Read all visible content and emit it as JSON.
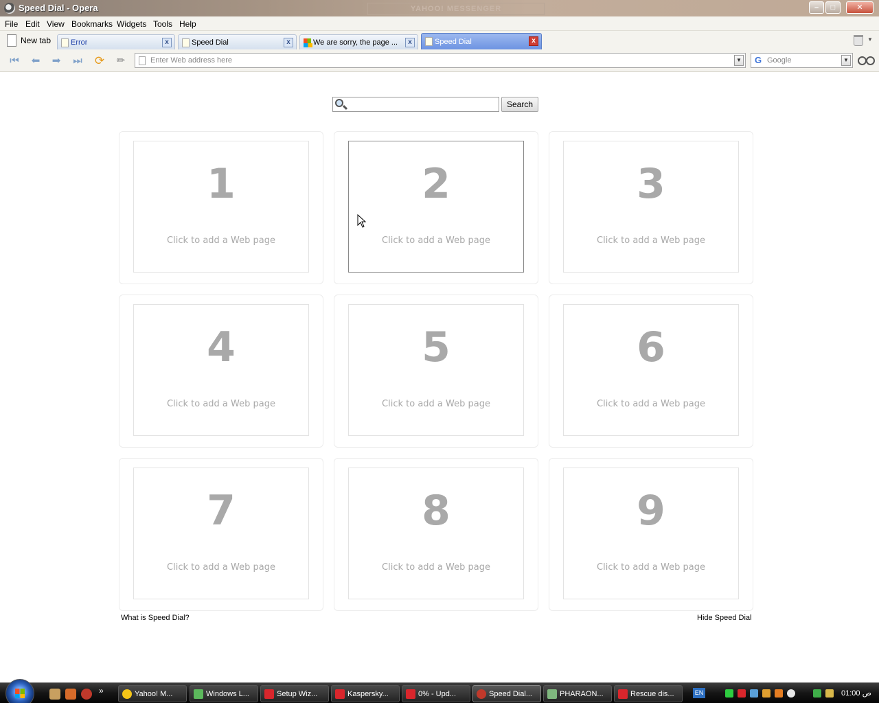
{
  "window": {
    "title": "Speed Dial - Opera",
    "background_watermark": "YAHOO! MESSENGER"
  },
  "menu": [
    "File",
    "Edit",
    "View",
    "Bookmarks",
    "Widgets",
    "Tools",
    "Help"
  ],
  "tabs": {
    "new_tab_label": "New tab",
    "items": [
      {
        "label": "Error",
        "icon": "page-icon",
        "active": false
      },
      {
        "label": "Speed Dial",
        "icon": "page-icon",
        "active": false
      },
      {
        "label": "We are sorry, the page ...",
        "icon": "windows-logo-icon",
        "active": false
      },
      {
        "label": "Speed Dial",
        "icon": "page-icon",
        "active": true
      }
    ]
  },
  "address_bar": {
    "placeholder": "Enter Web address here",
    "search_engine": "Google"
  },
  "speed_dial": {
    "search_button": "Search",
    "tiles": [
      {
        "number": "1",
        "hint": "Click to add a Web page"
      },
      {
        "number": "2",
        "hint": "Click to add a Web page"
      },
      {
        "number": "3",
        "hint": "Click to add a Web page"
      },
      {
        "number": "4",
        "hint": "Click to add a Web page"
      },
      {
        "number": "5",
        "hint": "Click to add a Web page"
      },
      {
        "number": "6",
        "hint": "Click to add a Web page"
      },
      {
        "number": "7",
        "hint": "Click to add a Web page"
      },
      {
        "number": "8",
        "hint": "Click to add a Web page"
      },
      {
        "number": "9",
        "hint": "Click to add a Web page"
      }
    ],
    "what_is_link": "What is Speed Dial?",
    "hide_link": "Hide Speed Dial"
  },
  "taskbar": {
    "tasks": [
      {
        "label": "Yahoo! M...",
        "icon": "yahoo-icon",
        "color": "#f5c518"
      },
      {
        "label": "Windows L...",
        "icon": "messenger-icon",
        "color": "#5cb85c"
      },
      {
        "label": "Setup Wiz...",
        "icon": "kaspersky-icon",
        "color": "#d9262c"
      },
      {
        "label": "Kaspersky...",
        "icon": "kaspersky-icon",
        "color": "#d9262c"
      },
      {
        "label": "0% - Upd...",
        "icon": "kaspersky-icon",
        "color": "#d9262c"
      },
      {
        "label": "Speed Dial...",
        "icon": "opera-icon",
        "color": "#c0392b"
      },
      {
        "label": "PHARAON...",
        "icon": "app-icon",
        "color": "#7fb77e"
      },
      {
        "label": "Rescue dis...",
        "icon": "kaspersky-icon",
        "color": "#d9262c"
      }
    ],
    "language": "EN",
    "clock": "01:00 ص"
  }
}
